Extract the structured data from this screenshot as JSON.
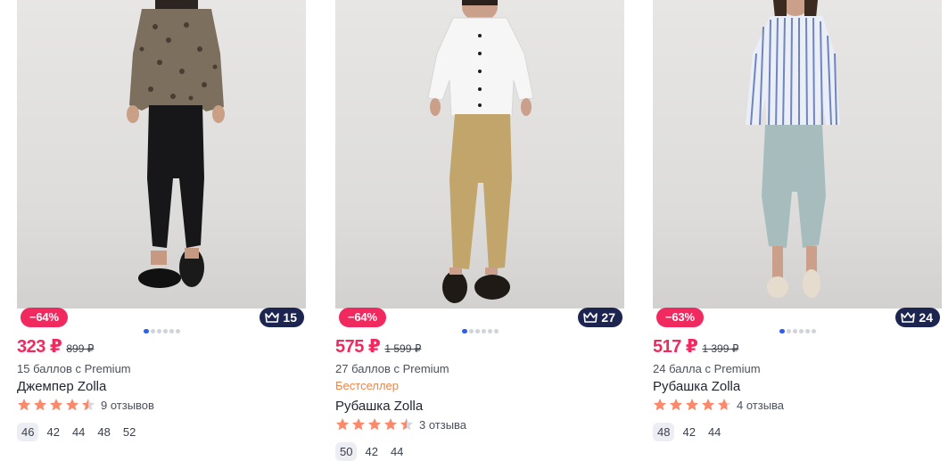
{
  "products": [
    {
      "discount": "−64%",
      "points": "15",
      "price": "323 ₽",
      "old_price": "899 ₽",
      "premium": "15 баллов с Premium",
      "bestseller": "",
      "title": "Джемпер Zolla",
      "rating": 4.5,
      "reviews": "9 отзывов",
      "sizes": [
        "46",
        "42",
        "44",
        "48",
        "52"
      ],
      "active_size": "46",
      "image_icon": "model-leopard-blouse-black-trousers"
    },
    {
      "discount": "−64%",
      "points": "27",
      "price": "575 ₽",
      "old_price": "1 599 ₽",
      "premium": "27 баллов с Premium",
      "bestseller": "Бестселлер",
      "title": "Рубашка Zolla",
      "rating": 4.5,
      "reviews": "3 отзыва",
      "sizes": [
        "50",
        "42",
        "44"
      ],
      "active_size": "50",
      "image_icon": "model-white-shirt-beige-trousers"
    },
    {
      "discount": "−63%",
      "points": "24",
      "price": "517 ₽",
      "old_price": "1 399 ₽",
      "premium": "24 балла с Premium",
      "bestseller": "",
      "title": "Рубашка Zolla",
      "rating": 4.7,
      "reviews": "4 отзыва",
      "sizes": [
        "48",
        "42",
        "44"
      ],
      "active_size": "48",
      "image_icon": "model-striped-shirt-light-trousers"
    }
  ],
  "colors": {
    "price": "#f0295e",
    "discount_badge": "#f0295e",
    "points_badge": "#1c2450",
    "bestseller": "#f5843f",
    "star": "#f98a6c",
    "star_empty": "#d6d8de",
    "dot_active": "#2d5ef0"
  }
}
